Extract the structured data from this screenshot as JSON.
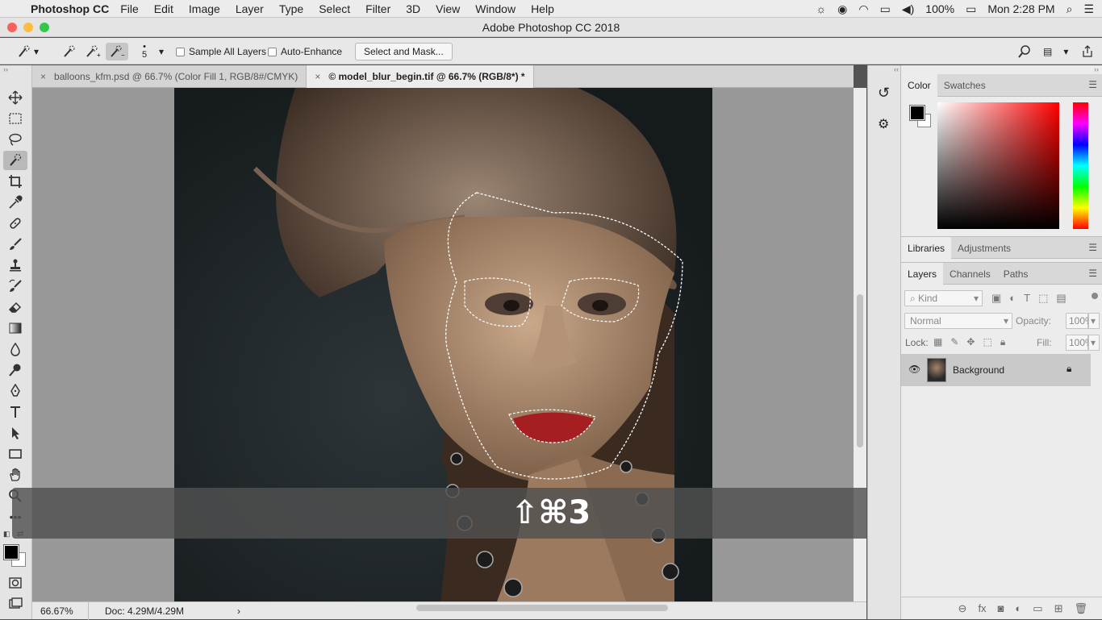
{
  "menubar": {
    "app_name": "Photoshop CC",
    "items": [
      "File",
      "Edit",
      "Image",
      "Layer",
      "Type",
      "Select",
      "Filter",
      "3D",
      "View",
      "Window",
      "Help"
    ],
    "battery": "100%",
    "clock": "Mon 2:28 PM"
  },
  "window": {
    "title": "Adobe Photoshop CC 2018"
  },
  "options": {
    "brush_size": "5",
    "sample_all_layers": "Sample All Layers",
    "auto_enhance": "Auto-Enhance",
    "select_and_mask": "Select and Mask..."
  },
  "doc_tabs": [
    {
      "label": "balloons_kfm.psd @ 66.7% (Color Fill 1, RGB/8#/CMYK)"
    },
    {
      "label": "© model_blur_begin.tif @ 66.7% (RGB/8*) *"
    }
  ],
  "shortcut_overlay": "⇧⌘3",
  "status": {
    "zoom": "66.67%",
    "doc": "Doc: 4.29M/4.29M"
  },
  "panels": {
    "color_tabs": [
      "Color",
      "Swatches"
    ],
    "lib_tabs": [
      "Libraries",
      "Adjustments"
    ],
    "layer_tabs": [
      "Layers",
      "Channels",
      "Paths"
    ],
    "kind_placeholder": "Kind",
    "blend_mode": "Normal",
    "opacity_label": "Opacity:",
    "opacity_value": "100%",
    "lock_label": "Lock:",
    "fill_label": "Fill:",
    "fill_value": "100%",
    "layer_name": "Background"
  },
  "colors": {
    "foreground": "#000000",
    "background": "#ffffff"
  }
}
